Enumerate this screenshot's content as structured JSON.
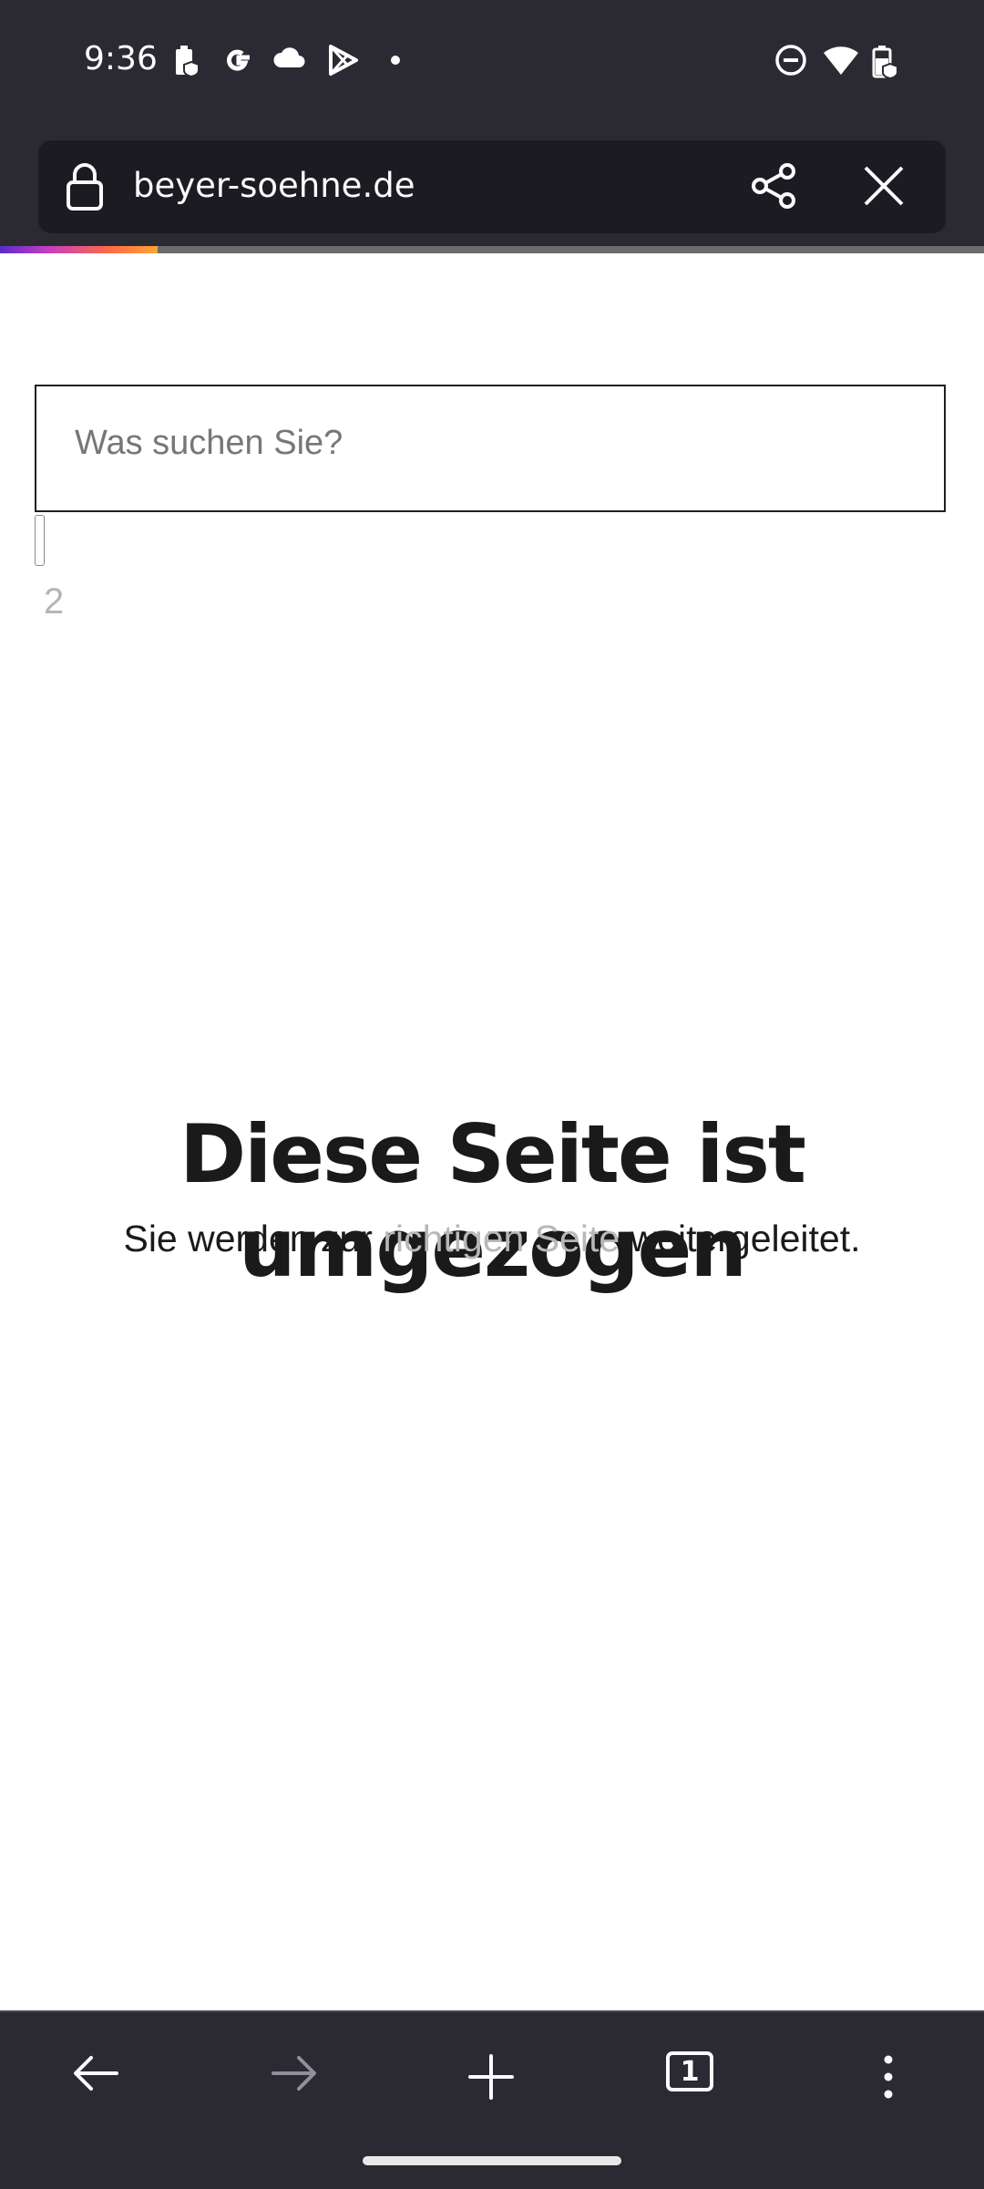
{
  "status_bar": {
    "time": "9:36",
    "left_icons": [
      "battery-saver-icon",
      "google-icon",
      "cloud-icon",
      "play-store-icon",
      "dot-icon"
    ],
    "right_icons": [
      "do-not-disturb-icon",
      "wifi-icon",
      "battery-icon"
    ]
  },
  "browser": {
    "url": "beyer-soehne.de",
    "load_progress": 0.16,
    "accent_gradient": [
      "#592acb",
      "#c43ec2",
      "#ff6a45",
      "#ffa436"
    ]
  },
  "page": {
    "search_placeholder": "Was suchen Sie?",
    "page_number": "2",
    "headline": "Diese Seite ist umgezogen",
    "sub_before": "Sie werden zur ",
    "sub_link": "richtigen Seite",
    "sub_after": " weitergeleitet."
  },
  "bottom_nav": {
    "tab_count": "1",
    "icons": [
      "back-arrow-icon",
      "forward-arrow-icon",
      "new-tab-plus-icon",
      "tabs-counter-icon",
      "overflow-menu-icon"
    ]
  },
  "colors": {
    "chrome_bg": "#2b2a33",
    "url_field_bg": "#1c1b22",
    "link_gray": "#b8b8b8"
  }
}
